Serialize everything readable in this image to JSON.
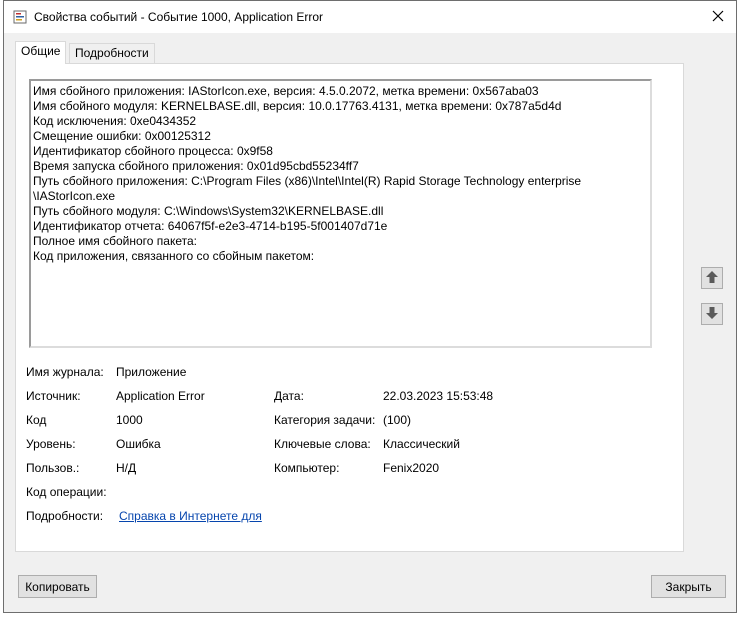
{
  "window": {
    "title": "Свойства событий - Событие 1000, Application Error"
  },
  "tabs": [
    {
      "label": "Общие"
    },
    {
      "label": "Подробности"
    }
  ],
  "description": [
    "Имя сбойного приложения: IAStorIcon.exe, версия: 4.5.0.2072, метка времени: 0x567aba03",
    "Имя сбойного модуля: KERNELBASE.dll, версия: 10.0.17763.4131, метка времени: 0x787a5d4d",
    "Код исключения: 0xe0434352",
    "Смещение ошибки: 0x00125312",
    "Идентификатор сбойного процесса: 0x9f58",
    "Время запуска сбойного приложения: 0x01d95cbd55234ff7",
    "Путь сбойного приложения: C:\\Program Files (x86)\\Intel\\Intel(R) Rapid Storage Technology enterprise",
    "\\IAStorIcon.exe",
    "Путь сбойного модуля: C:\\Windows\\System32\\KERNELBASE.dll",
    "Идентификатор отчета: 64067f5f-e2e3-4714-b195-5f001407d71e",
    "Полное имя сбойного пакета:",
    "Код приложения, связанного со сбойным пакетом:"
  ],
  "fields": {
    "log_name": {
      "label": "Имя журнала:",
      "value": "Приложение"
    },
    "source": {
      "label": "Источник:",
      "value": "Application Error"
    },
    "date": {
      "label": "Дата:",
      "value": "22.03.2023 15:53:48"
    },
    "code": {
      "label": "Код",
      "value": "1000"
    },
    "task_category": {
      "label": "Категория задачи:",
      "value": "(100)"
    },
    "level": {
      "label": "Уровень:",
      "value": "Ошибка"
    },
    "keywords": {
      "label": "Ключевые слова:",
      "value": "Классический"
    },
    "user": {
      "label": "Пользов.:",
      "value": "Н/Д"
    },
    "computer": {
      "label": "Компьютер:",
      "value": "Fenix2020"
    },
    "opcode": {
      "label": "Код операции:",
      "value": ""
    },
    "more_info": {
      "label": "Подробности:",
      "value": "Справка в Интернете для "
    }
  },
  "buttons": {
    "copy": "Копировать",
    "close": "Закрыть"
  },
  "icons": {
    "app": "event-viewer-icon",
    "close": "close-icon",
    "up": "arrow-up-icon",
    "down": "arrow-down-icon"
  }
}
